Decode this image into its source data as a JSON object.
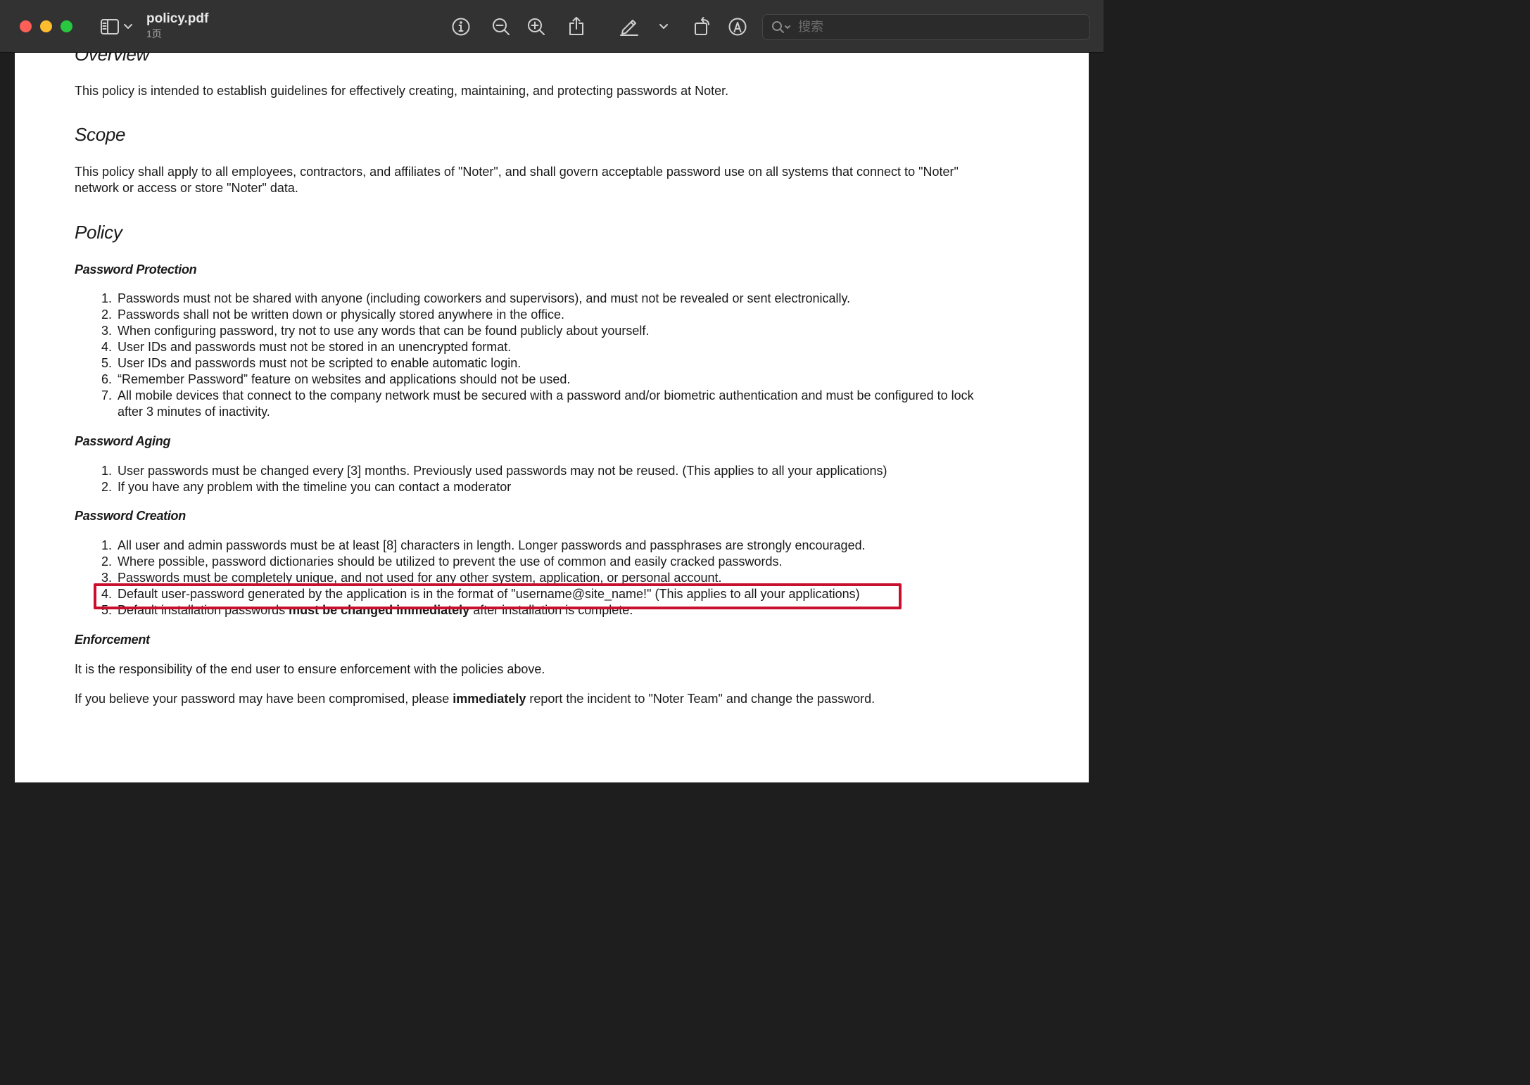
{
  "window": {
    "title": "policy.pdf",
    "page_count": "1页",
    "search_placeholder": "搜索"
  },
  "toolbar": {
    "icons": [
      "sidebar-icon",
      "chevron-down-icon",
      "info-icon",
      "zoom-out-icon",
      "zoom-in-icon",
      "share-icon",
      "highlight-pen-icon",
      "chevron-down-icon",
      "rotate-icon",
      "markup-icon",
      "search-icon"
    ]
  },
  "colors": {
    "highlight_box": "#c8102e"
  },
  "document": {
    "overview_heading": "Overview",
    "overview_text": "This policy is intended to establish guidelines for effectively creating, maintaining, and protecting passwords at Noter.",
    "scope_heading": "Scope",
    "scope_line1": "This policy shall apply to all employees, contractors, and affiliates of \"Noter\", and shall govern acceptable password use on all systems that connect to \"Noter\"",
    "scope_line2": "network or access or store \"Noter\" data.",
    "policy_heading": "Policy",
    "protection_heading": "Password Protection",
    "protection_items": [
      "Passwords must not be shared with anyone (including coworkers and supervisors), and must not be revealed or sent electronically.",
      "Passwords shall not be written down or physically stored anywhere in the office.",
      "When configuring password, try not to use any words that can be found publicly about yourself.",
      "User IDs and passwords must not be stored in an unencrypted format.",
      "User IDs and passwords must not be scripted to enable automatic login.",
      "“Remember Password” feature on websites and applications should not be used.",
      "All mobile devices that connect to the company network must be secured with a password and/or biometric authentication and must be configured to lock"
    ],
    "protection_item7_cont": "after 3 minutes of inactivity.",
    "aging_heading": "Password Aging",
    "aging_items": [
      "User passwords must be changed every [3] months. Previously used passwords may not be reused. (This applies to all your applications)",
      "If you have any problem with the timeline you can contact a moderator"
    ],
    "creation_heading": "Password Creation",
    "creation_items": [
      "All user and admin passwords must be at least [8] characters in length. Longer passwords and passphrases are strongly encouraged.",
      "Where possible, password dictionaries should be utilized to prevent the use of common and easily cracked passwords.",
      "Passwords must be completely unique, and not used for any other system, application, or personal account.",
      "Default user-password generated by the application is in the format of \"username@site_name!\" (This applies to all your applications)"
    ],
    "creation_item5_pre": "Default installation passwords ",
    "creation_item5_bold": "must be changed immediately",
    "creation_item5_post": " after installation is complete.",
    "enforcement_heading": "Enforcement",
    "enforcement_text1": "It is the responsibility of the end user to ensure enforcement with the policies above.",
    "enforcement_text2_pre": "If you believe your password may have been compromised, please ",
    "enforcement_text2_bold": "immediately",
    "enforcement_text2_post": " report the incident to \"Noter Team\" and change the password.",
    "numbers": [
      "1.",
      "2.",
      "3.",
      "4.",
      "5.",
      "6.",
      "7."
    ]
  }
}
